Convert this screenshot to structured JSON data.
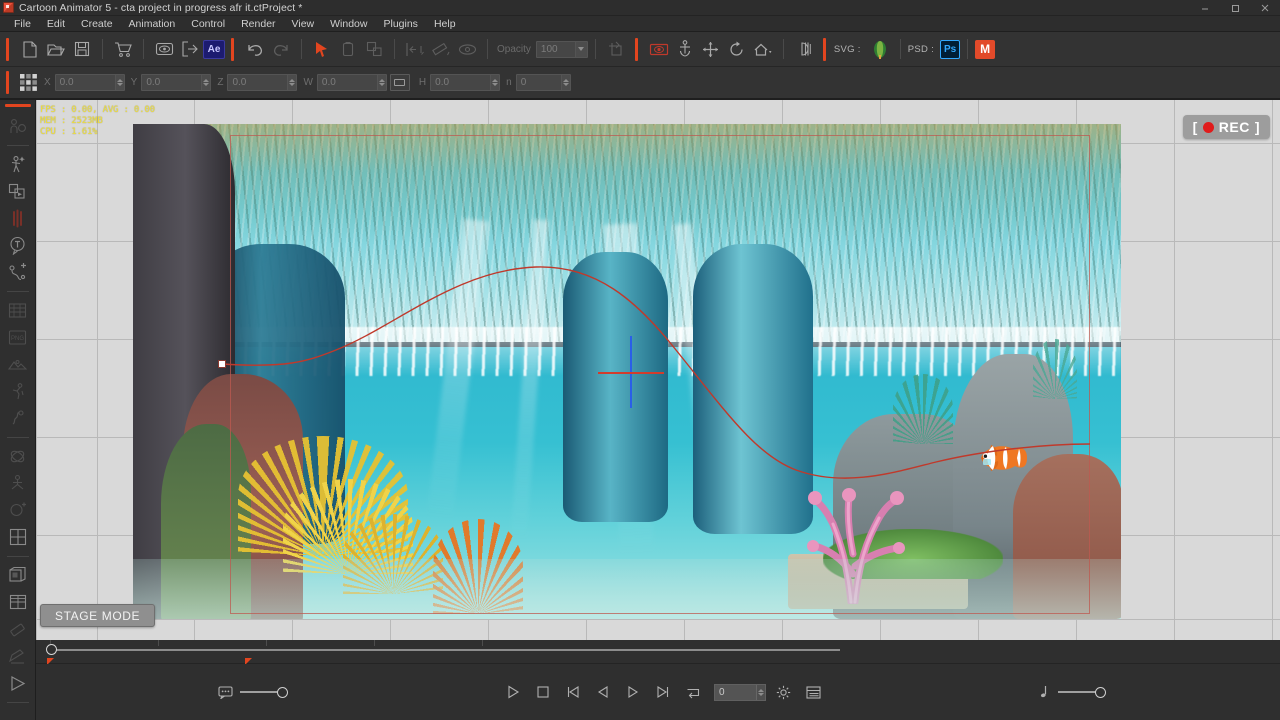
{
  "window": {
    "title": "Cartoon Animator 5 - cta project in progress afr it.ctProject *",
    "app_icon": "cartoon-animator-icon",
    "minimize": "–",
    "maximize": "❐",
    "close": "✕"
  },
  "menu": {
    "items": [
      {
        "label": "File"
      },
      {
        "label": "Edit"
      },
      {
        "label": "Create"
      },
      {
        "label": "Animation"
      },
      {
        "label": "Control"
      },
      {
        "label": "Render"
      },
      {
        "label": "View"
      },
      {
        "label": "Window"
      },
      {
        "label": "Plugins"
      },
      {
        "label": "Help"
      }
    ]
  },
  "toolbar_main": {
    "buttons": [
      {
        "name": "new-project-icon",
        "title": "New Project"
      },
      {
        "name": "open-project-icon",
        "title": "Open Project"
      },
      {
        "name": "save-project-icon",
        "title": "Save Project"
      },
      {
        "name": "content-store-icon",
        "title": "Content Store"
      },
      {
        "name": "preview-render-icon",
        "title": "Preview"
      },
      {
        "name": "export-icon",
        "title": "Export"
      },
      {
        "name": "after-effects-icon",
        "title": "Ae"
      },
      {
        "name": "undo-icon",
        "title": "Undo"
      },
      {
        "name": "redo-icon",
        "title": "Redo"
      },
      {
        "name": "select-tool-icon",
        "title": "Select"
      },
      {
        "name": "duplicate-icon",
        "title": "Duplicate"
      },
      {
        "name": "layers-icon",
        "title": "Layers"
      },
      {
        "name": "align-icon",
        "title": "Align"
      },
      {
        "name": "ruler-tool-icon",
        "title": "Measure"
      },
      {
        "name": "visibility-icon",
        "title": "Visibility"
      },
      {
        "name": "crop-icon",
        "title": "Crop"
      },
      {
        "name": "camera-icon",
        "title": "Camera"
      },
      {
        "name": "anchor-icon",
        "title": "Anchor"
      },
      {
        "name": "move-icon",
        "title": "Move"
      },
      {
        "name": "rotate-icon",
        "title": "Rotate"
      },
      {
        "name": "home-icon",
        "title": "Home View"
      },
      {
        "name": "mirror-icon",
        "title": "Mirror"
      }
    ],
    "ae_badge": "Ae",
    "opacity_label": "Opacity",
    "opacity_value": "100",
    "svg_label": "SVG :",
    "svg_app_icon": "coreldraw-icon",
    "psd_label": "PSD :",
    "psd_badge": "Ps",
    "extra_badge": "M"
  },
  "toolbar_transform": {
    "grid_icon": "transform-grid-icon",
    "fields": [
      {
        "label": "X",
        "value": "0.0"
      },
      {
        "label": "Y",
        "value": "0.0"
      },
      {
        "label": "Z",
        "value": "0.0"
      },
      {
        "label": "W",
        "value": "0.0"
      },
      {
        "label": "H",
        "value": "0.0"
      },
      {
        "label": "n",
        "value": "0"
      }
    ],
    "lock_ratio_icon": "lock-aspect-ratio-icon"
  },
  "left_toolbar": {
    "items": [
      {
        "name": "character-composer-icon",
        "state": "dim"
      },
      {
        "name": "motion-puppet-icon",
        "state": "on"
      },
      {
        "name": "sprite-editor-icon",
        "state": "on"
      },
      {
        "name": "face-puppet-icon",
        "state": "red"
      },
      {
        "name": "talking-head-icon",
        "state": "on"
      },
      {
        "name": "motion-path-icon",
        "state": "on"
      },
      {
        "name": "timeline-track-icon",
        "state": "dim"
      },
      {
        "name": "prop-png-icon",
        "state": "dim"
      },
      {
        "name": "terrain-icon",
        "state": "dim"
      },
      {
        "name": "run-motion-icon",
        "state": "dim"
      },
      {
        "name": "spring-icon",
        "state": "dim"
      },
      {
        "name": "physics-icon",
        "state": "dim"
      },
      {
        "name": "bone-rig-icon",
        "state": "dim"
      },
      {
        "name": "head-turn-icon",
        "state": "dim"
      },
      {
        "name": "grid-snap-icon",
        "state": "on"
      },
      {
        "name": "scene-cube-icon",
        "state": "on"
      },
      {
        "name": "camera-grid-icon",
        "state": "on"
      },
      {
        "name": "eraser-icon",
        "state": "dim"
      },
      {
        "name": "edit-note-icon",
        "state": "dim"
      },
      {
        "name": "play-tool-icon",
        "state": "on"
      }
    ]
  },
  "stage": {
    "performance_overlay": {
      "fps_line": "FPS : 0.00, AVG : 0.00",
      "mem_line": "MEM : 2523MB",
      "cpu_line": "CPU : 1.61%"
    },
    "rec_badge": {
      "open_bracket": "[",
      "label": "REC",
      "close_bracket": "]",
      "dot_color": "#e01b1b"
    },
    "stage_mode_label": "STAGE MODE",
    "motion_path_color": "#c0392b",
    "safe_frame_color": "#be5a50",
    "keyframe_marker": "keyframe-square",
    "crosshair_vertical_color": "#2a5fe8",
    "crosshair_horizontal_color": "#d23c2c",
    "background_color": "#d9d9d9"
  },
  "timeline": {
    "playhead_position_pct": 1,
    "markers": [
      {
        "position_pct": 1
      },
      {
        "position_pct": 16.5
      }
    ]
  },
  "transport": {
    "left_slider": {
      "icon": "speech-bubble-icon",
      "value_pct": 100
    },
    "buttons": [
      {
        "name": "play-button",
        "glyph": "play"
      },
      {
        "name": "stop-button",
        "glyph": "stop"
      },
      {
        "name": "first-frame-button",
        "glyph": "first"
      },
      {
        "name": "prev-frame-button",
        "glyph": "prev"
      },
      {
        "name": "next-frame-button",
        "glyph": "next"
      },
      {
        "name": "last-frame-button",
        "glyph": "last"
      },
      {
        "name": "loop-button",
        "glyph": "loop"
      }
    ],
    "frame_value": "0",
    "settings_icon": "gear-icon",
    "timeline_panel_icon": "timeline-panel-icon",
    "right_slider": {
      "icon": "music-note-icon",
      "value_pct": 100
    }
  }
}
